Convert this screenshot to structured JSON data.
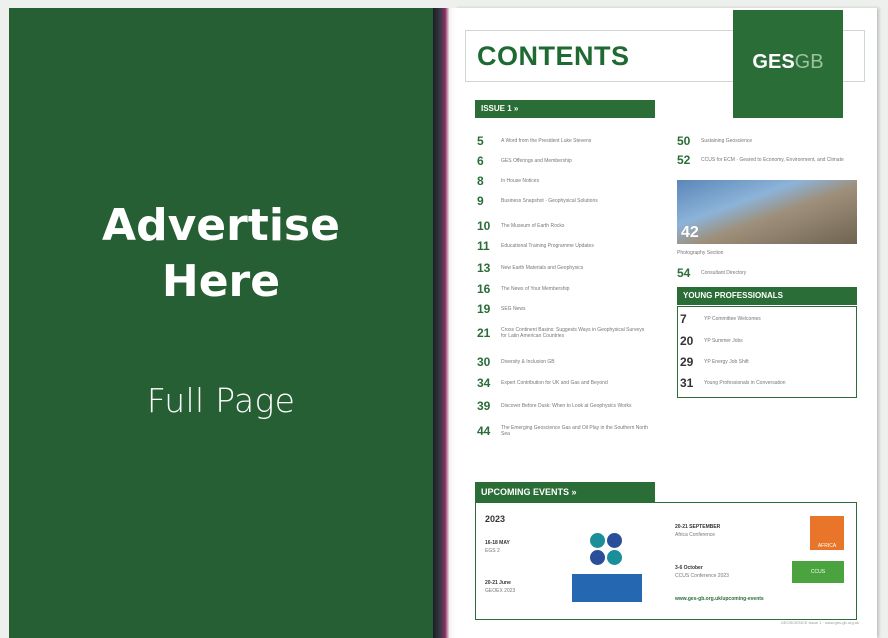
{
  "ad": {
    "title_line1": "Advertise",
    "title_line2": "Here",
    "subtitle": "Full Page"
  },
  "magazine": {
    "title": "CONTENTS",
    "logo_main": "GES",
    "logo_suffix": "GB",
    "issue_label": "ISSUE 1 »",
    "contents_left": [
      {
        "num": "5",
        "text": "A Word from the President Luke Stevens"
      },
      {
        "num": "6",
        "text": "GES Offerings and Membership"
      },
      {
        "num": "8",
        "text": "In House Notices"
      },
      {
        "num": "9",
        "text": "Business Snapshot · Geophysical Solutions"
      },
      {
        "num": "10",
        "text": "The Museum of Earth Rocks"
      },
      {
        "num": "11",
        "text": "Educational Training Programme Updates"
      },
      {
        "num": "13",
        "text": "New Earth Materials and Geophysics"
      },
      {
        "num": "16",
        "text": "The News of Your Membership"
      },
      {
        "num": "19",
        "text": "SEG News"
      },
      {
        "num": "21",
        "text": "Cross Continent Basins: Suggests Ways in Geophysical Surveys for Latin American Countries"
      },
      {
        "num": "30",
        "text": "Diversity & Inclusion GB"
      },
      {
        "num": "34",
        "text": "Expert Contribution for UK and Gas and Beyond"
      },
      {
        "num": "39",
        "text": "Discover Before Dusk: When to Look at Geophysics Works"
      },
      {
        "num": "44",
        "text": "The Emerging Geoscience Gas and Oil Play in the Southern North Sea"
      }
    ],
    "contents_right": [
      {
        "num": "50",
        "text": "Sustaining Geoscience"
      },
      {
        "num": "52",
        "text": "CCUS for ECM · Geared to Economy, Environment, and Climate"
      }
    ],
    "photo_num": "42",
    "photo_caption": "Photography Section",
    "contents_right_2": [
      {
        "num": "54",
        "text": "Consultant Directory"
      }
    ],
    "yp_label": "YOUNG PROFESSIONALS",
    "yp_items": [
      {
        "num": "7",
        "text": "YP Committee Welcomes"
      },
      {
        "num": "20",
        "text": "YP Summer Jobs"
      },
      {
        "num": "29",
        "text": "YP Energy Job Shift"
      },
      {
        "num": "31",
        "text": "Young Professionals in Conversation"
      }
    ],
    "events_label": "UPCOMING EVENTS »",
    "events_year": "2023",
    "events_left": [
      {
        "date": "16-18 MAY",
        "name": "EGS 2"
      },
      {
        "date": "20-21 June",
        "name": "GEOEX 2023"
      }
    ],
    "events_right": [
      {
        "date": "20-21 SEPTEMBER",
        "name": "Africa Conference"
      },
      {
        "date": "3-6 October",
        "name": "CCUS Conference 2023"
      }
    ],
    "cnv_logo_text": "",
    "africa_logo_text": "AFRICA",
    "ccus_logo_text": "CCUS",
    "events_link": "www.ges-gb.org.uk/upcoming-events",
    "footer": "GEOSCIENCE Issue 1 · www.ges-gb.org.uk"
  },
  "colors": {
    "panel_green": "#265f33",
    "brand_green": "#2a6d37"
  }
}
